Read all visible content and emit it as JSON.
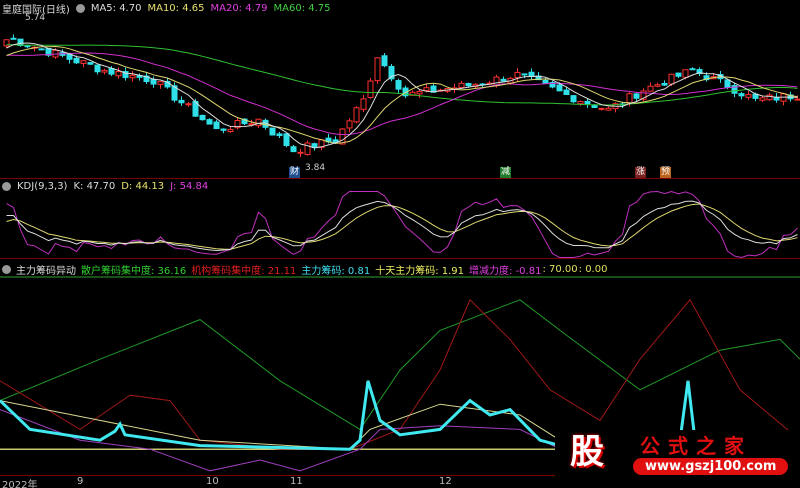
{
  "header": {
    "title": "皇庭国际(日线)",
    "ma5": "MA5: 4.70",
    "ma10": "MA10: 4.65",
    "ma20": "MA20: 4.79",
    "ma60": "MA60: 4.75"
  },
  "price": {
    "high_label": "5.74",
    "low_label": "3.84",
    "high": 5.74,
    "low": 3.84
  },
  "markers": [
    {
      "text": "财",
      "color": "#1e4f8f"
    },
    {
      "text": "减",
      "color": "#1f7a2a"
    },
    {
      "text": "涨",
      "color": "#7a1f1f"
    },
    {
      "text": "预",
      "color": "#b8641e"
    }
  ],
  "kdj": {
    "title": "KDJ(9,3,3)",
    "k": "K: 47.70",
    "d": "D: 44.13",
    "j": "J: 54.84"
  },
  "chips": {
    "title": "主力筹码异动",
    "retail": "散户筹码集中度: 36.16",
    "inst": "机构筹码集中度: 21.11",
    "main": "主力筹码: 0.81",
    "ten": "十天主力筹码: 1.91",
    "delta": "增减力度: -0.81",
    "v1": ": 70.00",
    "v2": ": 0.00"
  },
  "axis": [
    "2022年",
    "9",
    "10",
    "11",
    "12"
  ],
  "logo": {
    "char": "股",
    "name": "公式之家",
    "url": "www.gszj100.com"
  },
  "chart_data": {
    "type": "candlestick",
    "close_keypoints": [
      [
        1,
        5.45
      ],
      [
        14,
        5.04
      ],
      [
        21,
        4.91
      ],
      [
        30,
        4.24
      ],
      [
        36,
        4.38
      ],
      [
        41,
        3.97
      ],
      [
        47,
        4.11
      ],
      [
        51,
        4.64
      ],
      [
        53,
        5.24
      ],
      [
        57,
        4.71
      ],
      [
        66,
        4.84
      ],
      [
        73,
        4.98
      ],
      [
        80,
        4.71
      ],
      [
        86,
        4.51
      ],
      [
        91,
        4.78
      ],
      [
        98,
        5.04
      ],
      [
        103,
        4.84
      ],
      [
        107,
        4.64
      ],
      [
        113,
        4.71
      ]
    ],
    "bottom_series": [
      {
        "name": "散户筹码集中度",
        "color": "#1f9a2a",
        "x": [
          0,
          100,
          200,
          280,
          360,
          400,
          440,
          520,
          560,
          640,
          720,
          780,
          800
        ],
        "y": [
          33,
          56,
          78,
          44,
          17,
          50,
          72,
          89,
          72,
          39,
          61,
          67,
          56
        ]
      },
      {
        "name": "机构筹码集中度",
        "color": "#a01818",
        "x": [
          0,
          80,
          130,
          170,
          200,
          280,
          350,
          400,
          440,
          470,
          510,
          550,
          600,
          640,
          690,
          740,
          800
        ],
        "y": [
          44,
          17,
          36,
          33,
          11,
          6,
          6,
          17,
          50,
          89,
          67,
          39,
          22,
          56,
          89,
          39,
          11
        ]
      },
      {
        "name": "十天主力筹码",
        "color": "#d8d890",
        "x": [
          0,
          100,
          200,
          350,
          370,
          440,
          520,
          560,
          800
        ],
        "y": [
          33,
          22,
          11,
          6,
          17,
          31,
          25,
          11,
          8
        ]
      },
      {
        "name": "增减力度",
        "color": "#a040c0",
        "x": [
          0,
          80,
          150,
          210,
          260,
          300,
          360,
          380,
          440,
          520,
          560,
          700,
          800
        ],
        "y": [
          28,
          11,
          6,
          -6,
          0,
          -6,
          6,
          17,
          19,
          17,
          6,
          11,
          3
        ]
      },
      {
        "name": "主力筹码",
        "color": "#40e8f0",
        "x": [
          0,
          30,
          100,
          115,
          120,
          125,
          200,
          350,
          360,
          368,
          380,
          400,
          440,
          470,
          490,
          510,
          540,
          560,
          600,
          680,
          688,
          695,
          760,
          800
        ],
        "y": [
          33,
          17,
          11,
          16,
          20,
          14,
          8,
          6,
          11,
          44,
          22,
          14,
          17,
          33,
          25,
          28,
          11,
          8,
          8,
          11,
          44,
          11,
          11,
          8
        ]
      }
    ],
    "baseline": 6
  }
}
